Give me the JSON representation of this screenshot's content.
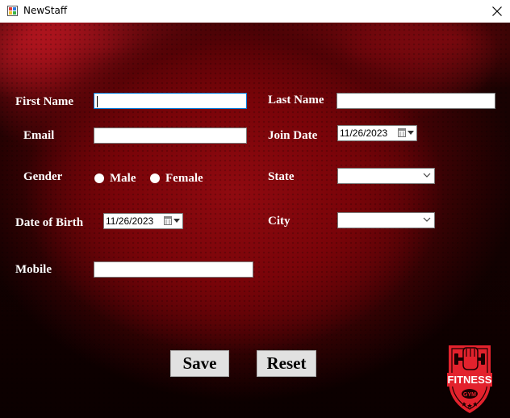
{
  "window": {
    "title": "NewStaff"
  },
  "form": {
    "first_name": {
      "label": "First Name",
      "value": ""
    },
    "last_name": {
      "label": "Last Name",
      "value": ""
    },
    "email": {
      "label": "Email",
      "value": ""
    },
    "join_date": {
      "label": "Join Date",
      "value": "11/26/2023"
    },
    "gender": {
      "label": "Gender",
      "options": [
        "Male",
        "Female"
      ]
    },
    "state": {
      "label": "State",
      "value": ""
    },
    "dob": {
      "label": "Date of Birth",
      "value": "11/26/2023"
    },
    "city": {
      "label": "City",
      "value": ""
    },
    "mobile": {
      "label": "Mobile",
      "value": ""
    }
  },
  "buttons": {
    "save": "Save",
    "reset": "Reset"
  },
  "logo": {
    "line1": "FITNESS",
    "line2": "GYM"
  },
  "colors": {
    "accent_red": "#c8111c",
    "logo_red": "#e3222d",
    "button_face": "#e1e1e1"
  }
}
